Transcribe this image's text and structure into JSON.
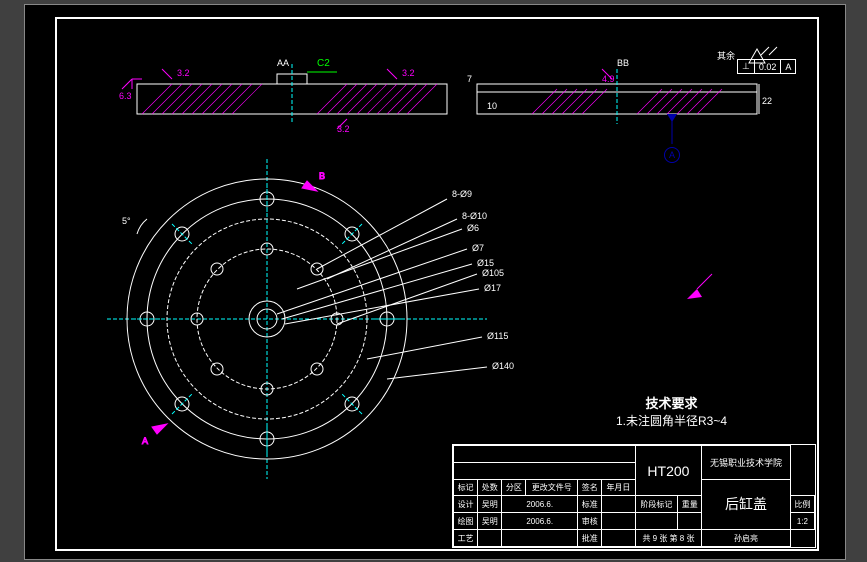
{
  "drawing": {
    "surface_note_top_right": "其余",
    "section_labels": {
      "aa": "AA",
      "c2": "C2",
      "bb": "BB"
    },
    "tolerance_box": {
      "symbol": "⊥",
      "value": "0.02",
      "datum": "A"
    },
    "datum_symbol": "A",
    "dimensions_left_section": {
      "d1": "6.3",
      "d2": "3.2",
      "d3": "3.2"
    },
    "dimensions_right_section": {
      "d1": "7",
      "d2": "10",
      "d3": "4.9",
      "d4": "22"
    },
    "hole_callouts": {
      "c1": "8-Ø9",
      "c2": "8-Ø10",
      "c3": "Ø6",
      "c4": "Ø7",
      "c5": "Ø15",
      "c6": "Ø105",
      "c7": "Ø17",
      "c8": "Ø115",
      "c9": "Ø140"
    },
    "angle": "5°",
    "section_cut": "A",
    "section_cut2": "B"
  },
  "requirements": {
    "title": "技术要求",
    "line1": "1.未注圆角半径R3~4"
  },
  "title_block": {
    "material": "HT200",
    "part_name": "后缸盖",
    "school": "无锡职业技术学院",
    "designer_label": "设计",
    "designer_name": "吴明",
    "designer_date": "2006.6.",
    "check_label": "绘图",
    "check_name": "吴明",
    "check_date": "2006.6.",
    "审核_label": "审核",
    "标准_label": "标准",
    "工艺_label": "工艺",
    "批准_label": "批准",
    "标记_label": "标记",
    "处数_label": "处数",
    "分区_label": "分区",
    "更改文件号_label": "更改文件号",
    "签名_label": "签名",
    "年月日_label": "年月日",
    "阶段标记_label": "阶段标记",
    "重量_label": "重量",
    "比例_label": "比例",
    "scale": "1:2",
    "sheet_info": "共 9 张  第 8 张",
    "author": "孙启亮"
  }
}
